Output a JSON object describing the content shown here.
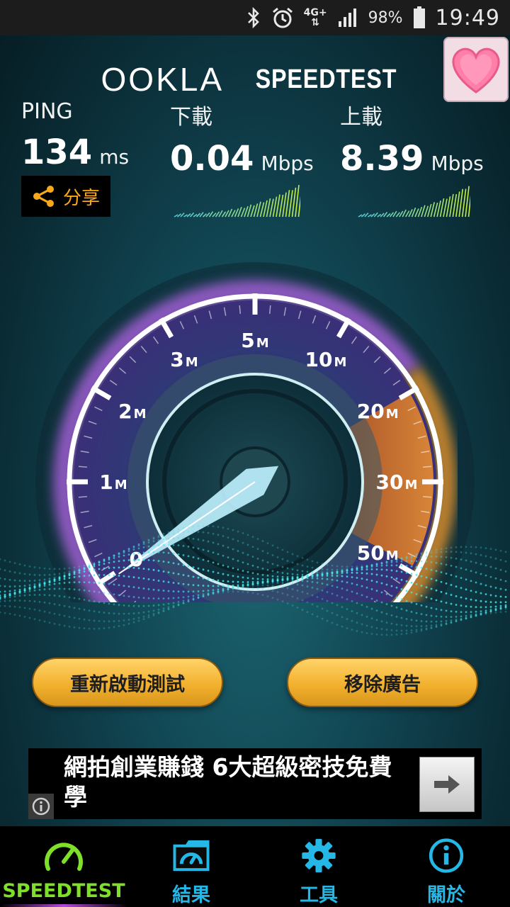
{
  "status_bar": {
    "network": "4G+",
    "battery": "98%",
    "time": "19:49",
    "icons": [
      "bluetooth-icon",
      "alarm-icon",
      "network-arrows-icon",
      "signal-icon",
      "battery-icon"
    ]
  },
  "header": {
    "logo_ookla": "OOKLA",
    "logo_speedtest": "SPEEDTEST",
    "badge_icon": "heart-icon"
  },
  "stats": {
    "ping": {
      "label": "PING",
      "value": "134",
      "unit": "ms"
    },
    "download": {
      "label": "下載",
      "value": "0.04",
      "unit": "Mbps"
    },
    "upload": {
      "label": "上載",
      "value": "8.39",
      "unit": "Mbps"
    }
  },
  "share": {
    "label": "分享",
    "icon": "share-icon"
  },
  "gauge": {
    "labels": [
      {
        "num": "0",
        "unit": ""
      },
      {
        "num": "1",
        "unit": "M"
      },
      {
        "num": "2",
        "unit": "M"
      },
      {
        "num": "3",
        "unit": "M"
      },
      {
        "num": "5",
        "unit": "M"
      },
      {
        "num": "10",
        "unit": "M"
      },
      {
        "num": "20",
        "unit": "M"
      },
      {
        "num": "30",
        "unit": "M"
      },
      {
        "num": "50",
        "unit": "M"
      }
    ],
    "needle_value_mbps": 0.04,
    "colors": {
      "ring": "#ffffff",
      "glow_left": "#b565e8",
      "glow_right": "#f39a2c",
      "needle": "#bff2ff"
    }
  },
  "actions": {
    "restart": "重新啟動測試",
    "remove_ads": "移除廣告"
  },
  "ad": {
    "text": "網拍創業賺錢 6大超級密技免費學",
    "info_icon": "info-icon",
    "arrow_icon": "arrow-right-icon"
  },
  "nav": [
    {
      "label": "SPEEDTEST",
      "icon": "speedometer-icon",
      "active": true
    },
    {
      "label": "結果",
      "icon": "results-folder-icon",
      "active": false
    },
    {
      "label": "工具",
      "icon": "gear-icon",
      "active": false
    },
    {
      "label": "關於",
      "icon": "info-icon",
      "active": false
    }
  ],
  "theme": {
    "accent_orange": "#f7a81c",
    "accent_green": "#7fe02a",
    "accent_blue": "#25b7e6"
  }
}
